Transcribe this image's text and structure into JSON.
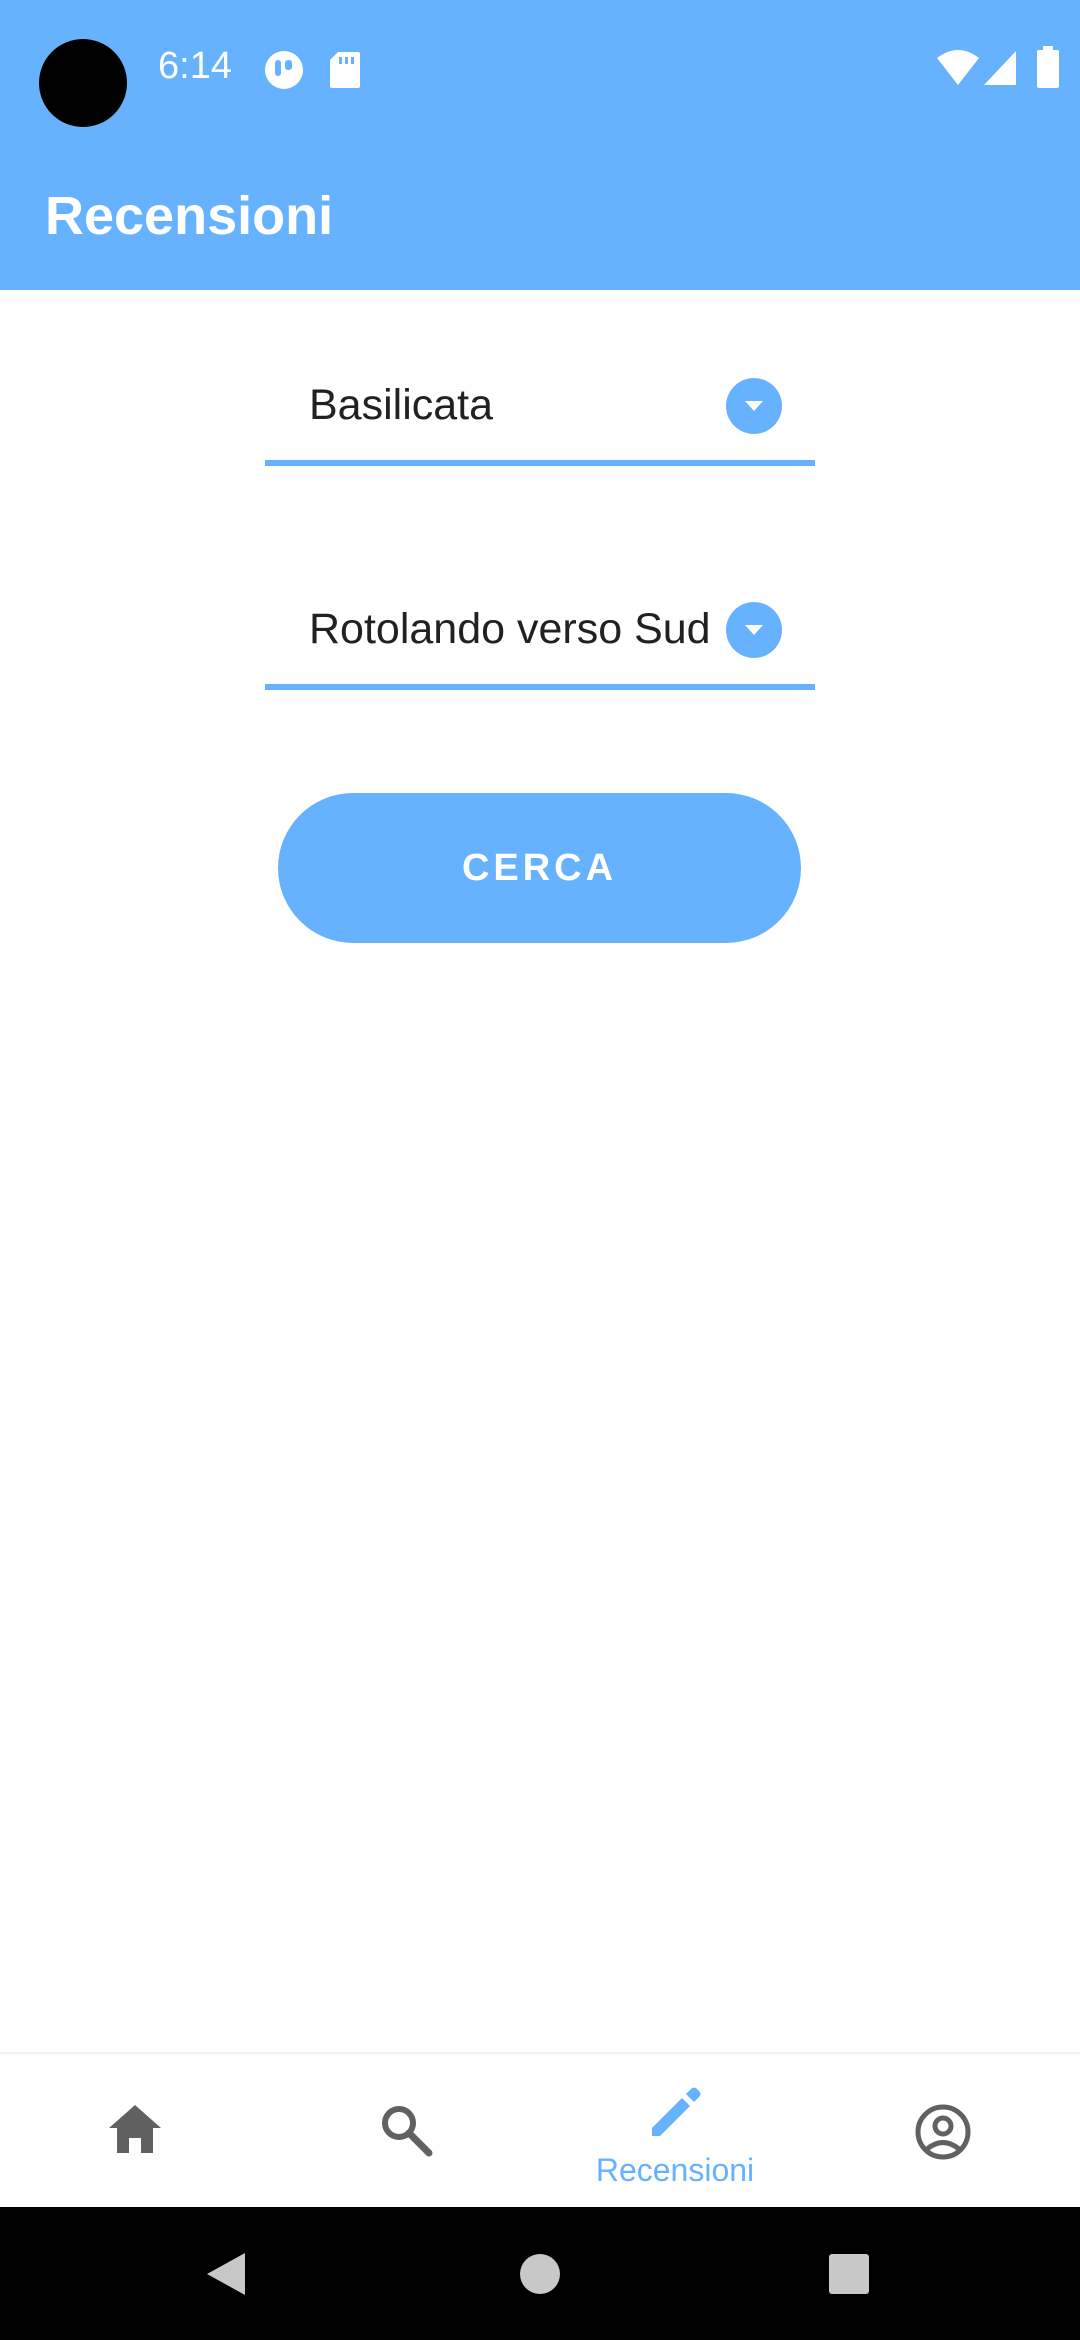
{
  "status_bar": {
    "time": "6:14",
    "icons": [
      "notification-app-icon",
      "sd-card-icon",
      "wifi-icon",
      "cell-signal-icon",
      "battery-icon"
    ]
  },
  "app_bar": {
    "title": "Recensioni"
  },
  "form": {
    "region_dropdown": {
      "selected": "Basilicata"
    },
    "restaurant_dropdown": {
      "selected": "Rotolando verso Sud"
    },
    "search_button_label": "CERCA"
  },
  "bottom_nav": {
    "items": [
      {
        "icon": "home-icon",
        "label": "",
        "active": false
      },
      {
        "icon": "search-icon",
        "label": "",
        "active": false
      },
      {
        "icon": "edit-icon",
        "label": "Recensioni",
        "active": true
      },
      {
        "icon": "account-icon",
        "label": "",
        "active": false
      }
    ]
  },
  "system_nav": {
    "icons": [
      "back-icon",
      "home-circle-icon",
      "recents-icon"
    ]
  },
  "colors": {
    "primary": "#66b2ff",
    "inactive_icon": "#616161",
    "text": "#212121"
  }
}
